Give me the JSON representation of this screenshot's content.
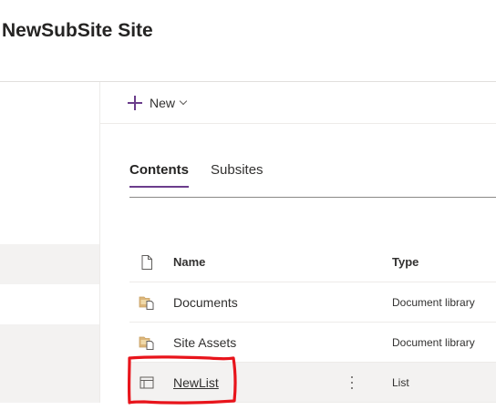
{
  "site": {
    "title": "NewSubSite Site"
  },
  "command_bar": {
    "new_label": "New"
  },
  "tabs": [
    {
      "label": "Contents",
      "selected": true
    },
    {
      "label": "Subsites",
      "selected": false
    }
  ],
  "table": {
    "headers": {
      "name": "Name",
      "type": "Type"
    },
    "rows": [
      {
        "name": "Documents",
        "type": "Document library",
        "icon": "document-library-icon"
      },
      {
        "name": "Site Assets",
        "type": "Document library",
        "icon": "document-library-icon"
      },
      {
        "name": "NewList",
        "type": "List",
        "icon": "list-icon"
      }
    ]
  },
  "colors": {
    "accent": "#6b3d8c",
    "annotation": "#e8141b",
    "nav_band": "#f3f2f1"
  }
}
